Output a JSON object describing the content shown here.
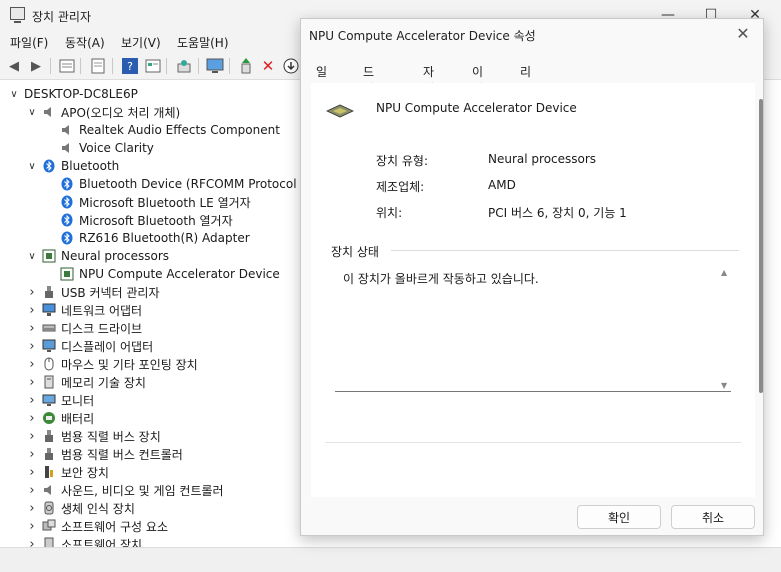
{
  "main_window": {
    "title": "장치 관리자",
    "controls": {
      "minimize": "—",
      "maximize": "☐",
      "close": "✕"
    }
  },
  "menu": [
    "파일(F)",
    "동작(A)",
    "보기(V)",
    "도움말(H)"
  ],
  "toolbar": [
    "back-arrow-icon",
    "forward-arrow-icon",
    "properties-icon",
    "document-icon",
    "help-icon",
    "view-icon",
    "scan-icon",
    "monitor-icon",
    "add-driver-icon",
    "remove-icon",
    "download-icon"
  ],
  "tree": {
    "root": "DESKTOP-DC8LE6P",
    "nodes": [
      {
        "label": "APO(오디오 처리 개체)",
        "level": 1,
        "expanded": true,
        "icon": "speaker-icon"
      },
      {
        "label": "Realtek Audio Effects Component",
        "level": 2,
        "icon": "speaker-icon"
      },
      {
        "label": "Voice Clarity",
        "level": 2,
        "icon": "speaker-icon"
      },
      {
        "label": "Bluetooth",
        "level": 1,
        "expanded": true,
        "icon": "bluetooth-icon"
      },
      {
        "label": "Bluetooth Device (RFCOMM Protocol TDI)",
        "level": 2,
        "icon": "bluetooth-icon"
      },
      {
        "label": "Microsoft Bluetooth LE 열거자",
        "level": 2,
        "icon": "bluetooth-icon"
      },
      {
        "label": "Microsoft Bluetooth 열거자",
        "level": 2,
        "icon": "bluetooth-icon"
      },
      {
        "label": "RZ616 Bluetooth(R) Adapter",
        "level": 2,
        "icon": "bluetooth-icon"
      },
      {
        "label": "Neural processors",
        "level": 1,
        "expanded": true,
        "icon": "chip-icon"
      },
      {
        "label": "NPU Compute Accelerator Device",
        "level": 2,
        "icon": "chip-icon"
      },
      {
        "label": "USB 커넥터 관리자",
        "level": 1,
        "icon": "usb-icon"
      },
      {
        "label": "네트워크 어댑터",
        "level": 1,
        "icon": "network-icon"
      },
      {
        "label": "디스크 드라이브",
        "level": 1,
        "icon": "disk-icon"
      },
      {
        "label": "디스플레이 어댑터",
        "level": 1,
        "icon": "display-icon"
      },
      {
        "label": "마우스 및 기타 포인팅 장치",
        "level": 1,
        "icon": "mouse-icon"
      },
      {
        "label": "메모리 기술 장치",
        "level": 1,
        "icon": "memory-icon"
      },
      {
        "label": "모니터",
        "level": 1,
        "icon": "monitor-icon"
      },
      {
        "label": "배터리",
        "level": 1,
        "icon": "battery-icon"
      },
      {
        "label": "범용 직렬 버스 장치",
        "level": 1,
        "icon": "usb-icon"
      },
      {
        "label": "범용 직렬 버스 컨트롤러",
        "level": 1,
        "icon": "usb-icon"
      },
      {
        "label": "보안 장치",
        "level": 1,
        "icon": "security-icon"
      },
      {
        "label": "사운드, 비디오 및 게임 컨트롤러",
        "level": 1,
        "icon": "speaker-icon"
      },
      {
        "label": "생체 인식 장치",
        "level": 1,
        "icon": "fingerprint-icon"
      },
      {
        "label": "소프트웨어 구성 요소",
        "level": 1,
        "icon": "component-icon"
      },
      {
        "label": "소프트웨어 장치",
        "level": 1,
        "icon": "device-icon"
      }
    ]
  },
  "dialog": {
    "title": "NPU Compute Accelerator Device 속성",
    "close": "✕",
    "tabs": [
      "일반",
      "드라이버",
      "자세히",
      "이벤트",
      "리소스"
    ],
    "selected_tab": "일반",
    "device_name": "NPU Compute Accelerator Device",
    "fields": [
      {
        "label": "장치 유형:",
        "value": "Neural processors"
      },
      {
        "label": "제조업체:",
        "value": "AMD"
      },
      {
        "label": "위치:",
        "value": "PCI 버스 6, 장치 0, 기능 1"
      }
    ],
    "status_label": "장치 상태",
    "status_text": "이 장치가 올바르게 작동하고 있습니다.",
    "ok": "확인",
    "cancel": "취소"
  },
  "colors": {
    "bluetooth": "#1e6fd9",
    "remove": "#e02020",
    "accent": "#1a1a1a"
  }
}
